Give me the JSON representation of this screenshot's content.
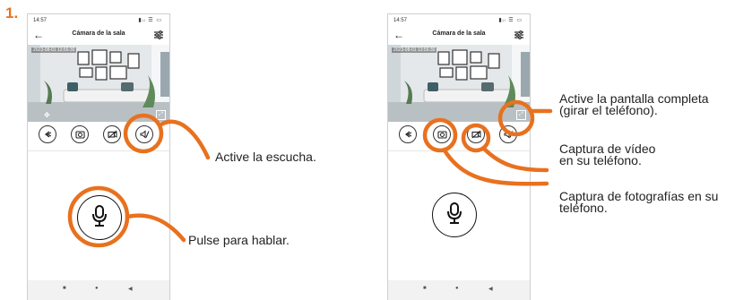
{
  "step_number": "1.",
  "phone": {
    "status_time": "14:57",
    "status_icons": "▮ᵢₗ ☰ ▭",
    "title": "Cámara de la sala",
    "feed_timestamp": "2023-08-01 13:56:30",
    "nav": {
      "square": "■",
      "circle": "●",
      "back": "◀"
    }
  },
  "labels": {
    "listen": "Active la escucha.",
    "talk": "Pulse para hablar.",
    "fullscreen_line1": "Active la pantalla completa",
    "fullscreen_line2": "(girar el teléfono).",
    "video_line1": "Captura de vídeo",
    "video_line2": "en su teléfono.",
    "photo_line1": "Captura de fotografías en su",
    "photo_line2": "teléfono."
  },
  "colors": {
    "accent": "#e8711f",
    "outline": "#222222"
  },
  "icons": {
    "left_controls": [
      "camera-switch-icon",
      "camera-icon",
      "video-record-icon",
      "speaker-mute-icon"
    ],
    "settings": "settings-sliders-icon",
    "mic": "microphone-icon",
    "fullscreen": "fullscreen-icon"
  }
}
